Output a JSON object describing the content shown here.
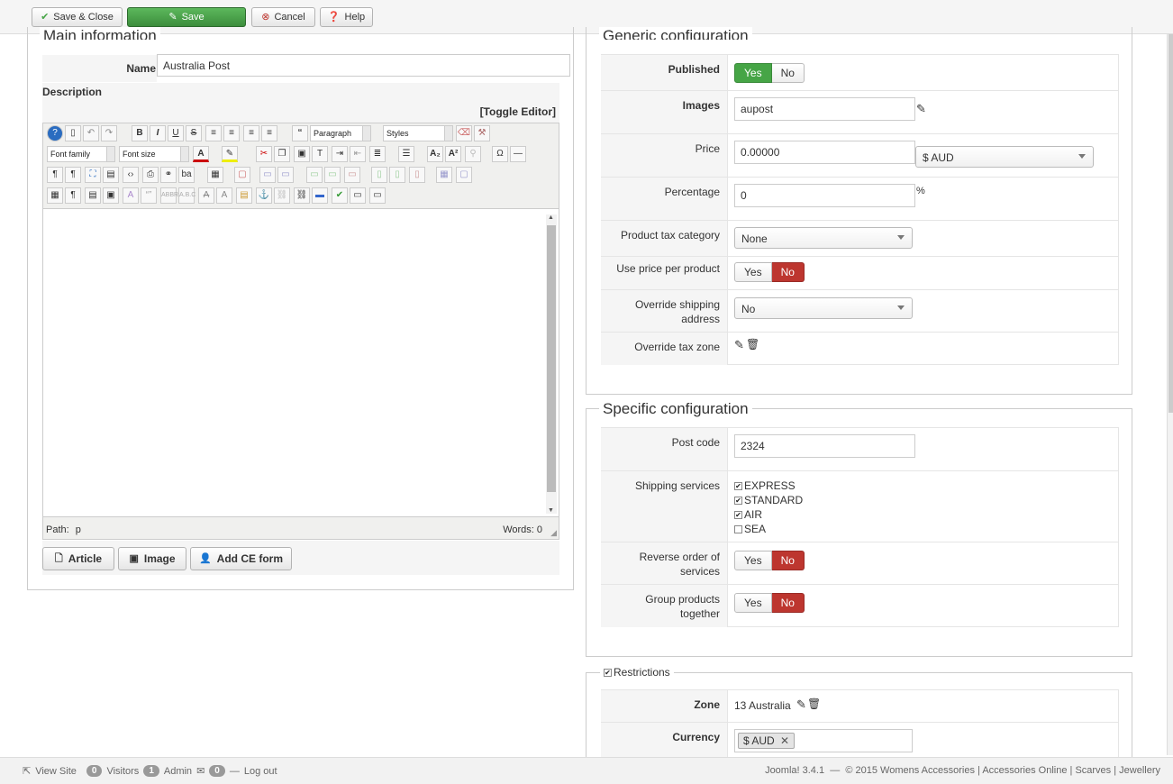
{
  "toolbar": {
    "save_close": "Save & Close",
    "save": "Save",
    "cancel": "Cancel",
    "help": "Help"
  },
  "main": {
    "legend": "Main information",
    "name_label": "Name",
    "name_value": "Australia Post",
    "description_label": "Description",
    "toggle_editor": "[Toggle Editor]",
    "editor": {
      "paragraph": "Paragraph",
      "styles": "Styles",
      "font_family": "Font family",
      "font_size": "Font size",
      "path_label": "Path:",
      "path_value": "p",
      "words": "Words: 0"
    },
    "buttons": {
      "article": "Article",
      "image": "Image",
      "add_ce_form": "Add CE form"
    }
  },
  "generic": {
    "legend": "Generic configuration",
    "published_label": "Published",
    "yes": "Yes",
    "no": "No",
    "images_label": "Images",
    "images_value": "aupost",
    "price_label": "Price",
    "price_value": "0.00000",
    "currency_value": "$ AUD",
    "percentage_label": "Percentage",
    "percentage_value": "0",
    "percent_sign": "%",
    "tax_category_label": "Product tax category",
    "tax_category_value": "None",
    "price_per_product_label": "Use price per product",
    "override_shipping_label": "Override shipping address",
    "override_shipping_value": "No",
    "override_tax_label": "Override tax zone"
  },
  "specific": {
    "legend": "Specific configuration",
    "postcode_label": "Post code",
    "postcode_value": "2324",
    "services_label": "Shipping services",
    "services": [
      {
        "label": "EXPRESS",
        "checked": true
      },
      {
        "label": "STANDARD",
        "checked": true
      },
      {
        "label": "AIR",
        "checked": true
      },
      {
        "label": "SEA",
        "checked": false
      }
    ],
    "reverse_label": "Reverse order of services",
    "group_label": "Group products together"
  },
  "restrictions": {
    "legend": "Restrictions",
    "zone_label": "Zone",
    "zone_value": "13 Australia",
    "currency_label": "Currency",
    "currency_tag": "$ AUD"
  },
  "status": {
    "view_site": "View Site",
    "visitors_count": "0",
    "visitors": "Visitors",
    "admin_count": "1",
    "admin": "Admin",
    "mail_count": "0",
    "logout": "Log out",
    "footer": "Joomla! 3.4.1  —  © 2015 Womens Accessories | Accessories Online | Scarves | Jewellery"
  },
  "colors": {
    "green": "#46a546",
    "red": "#bd362f"
  }
}
